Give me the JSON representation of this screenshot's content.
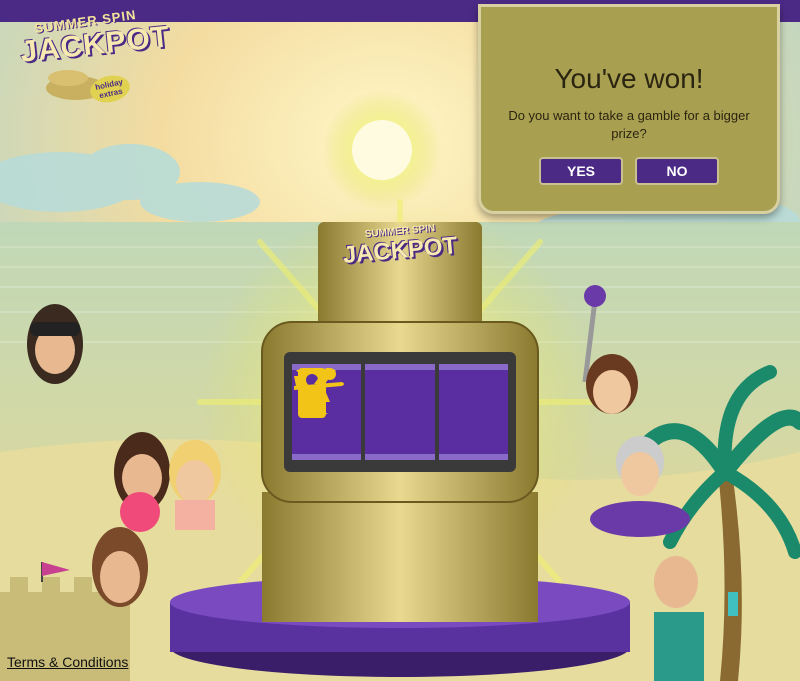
{
  "logo": {
    "line1": "SUMMER SPIN",
    "line2": "JACKPOT",
    "badge": "holiday extras"
  },
  "machine_sign": {
    "line1": "SUMMER SPIN",
    "line2": "JACKPOT"
  },
  "reels": [
    {
      "icon": "cocktail-icon"
    },
    {
      "icon": "door-hanger-icon"
    },
    {
      "icon": "airplane-icon"
    }
  ],
  "dialog": {
    "title": "You've won!",
    "message": "Do you want to take a gamble for a bigger prize?",
    "yes_label": "YES",
    "no_label": "NO"
  },
  "footer": {
    "terms_label": "Terms & Conditions"
  },
  "colors": {
    "brand_purple": "#4b2a86",
    "dialog_bg": "#a8a050",
    "reel_purple": "#5a2ea0",
    "symbol_yellow": "#f2c418"
  }
}
